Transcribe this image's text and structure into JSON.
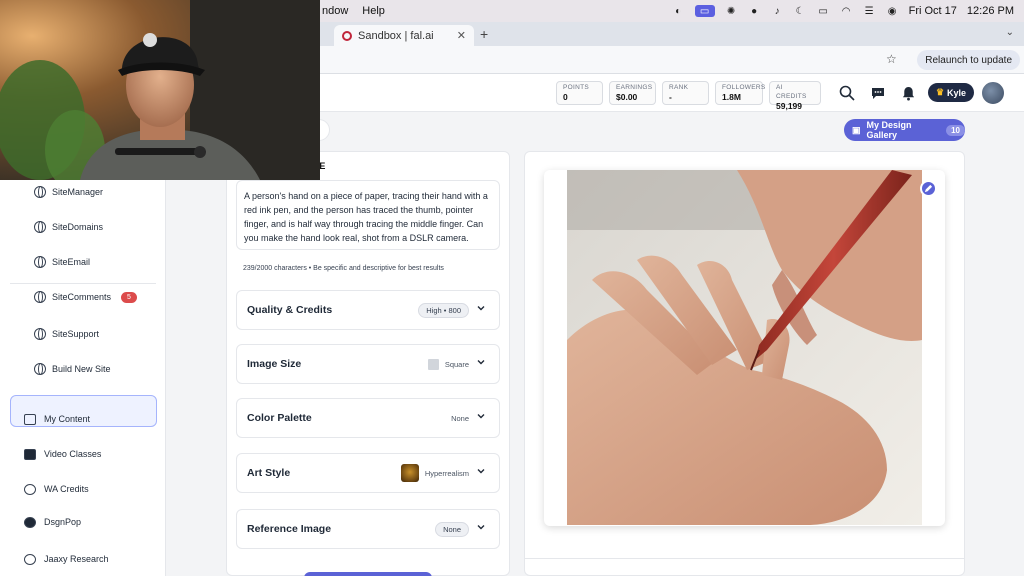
{
  "menubar": {
    "menu_items": [
      "ndow",
      "Help"
    ],
    "date": "Fri Oct 17",
    "time": "12:26 PM",
    "status_icons": [
      "dropbox-icon",
      "screen-share-icon",
      "vpn-icon",
      "github-icon",
      "music-icon",
      "moon-icon",
      "battery-icon",
      "wifi-icon",
      "control-center-icon",
      "siri-icon"
    ]
  },
  "browser": {
    "tabs": [
      {
        "label": "Sandbox | fal.ai",
        "active": true
      }
    ],
    "relaunch_label": "Relaunch to update"
  },
  "header": {
    "stats": [
      {
        "label": "POINTS",
        "value": "0"
      },
      {
        "label": "EARNINGS",
        "value": "$0.00"
      },
      {
        "label": "RANK",
        "value": "-"
      },
      {
        "label": "FOLLOWERS",
        "value": "1.8M"
      },
      {
        "label": "CREDITS",
        "value": "59,199",
        "prefix": "AI"
      }
    ],
    "user_name": "Kyle"
  },
  "sidebar": {
    "site_items": [
      {
        "label": "SiteManager"
      },
      {
        "label": "SiteDomains"
      },
      {
        "label": "SiteEmail"
      },
      {
        "label": "SiteComments",
        "badge": "5"
      },
      {
        "label": "SiteSupport"
      },
      {
        "label": "Build New Site"
      }
    ],
    "main_items": [
      {
        "label": "My Content",
        "icon": "content-icon"
      },
      {
        "label": "Video Classes",
        "icon": "video-icon"
      },
      {
        "label": "WA Credits",
        "icon": "credits-icon"
      },
      {
        "label": "DsgnPop",
        "icon": "palette-icon",
        "active": true
      },
      {
        "label": "Jaaxy Research",
        "icon": "research-icon"
      }
    ]
  },
  "main": {
    "gallery_button": "My Design Gallery",
    "gallery_count": "10",
    "panel_title": "GE",
    "prompt": "A person's hand on a piece of paper, tracing their hand with a red ink pen, and the person has traced the thumb, pointer finger, and is half way through tracing the middle finger.  Can you make the hand look real, shot from a DSLR camera.",
    "char_count": "239/2000 characters • Be specific and descriptive for best results",
    "options": [
      {
        "label": "Quality & Credits",
        "value": "High • 800"
      },
      {
        "label": "Image Size",
        "value": "Square"
      },
      {
        "label": "Color Palette",
        "value": "None"
      },
      {
        "label": "Art Style",
        "value": "Hyperrealism"
      },
      {
        "label": "Reference Image",
        "value": "None"
      }
    ]
  },
  "colors": {
    "accent": "#5b62d6",
    "badge": "#dc4b4b",
    "pen": "#b5362c"
  }
}
